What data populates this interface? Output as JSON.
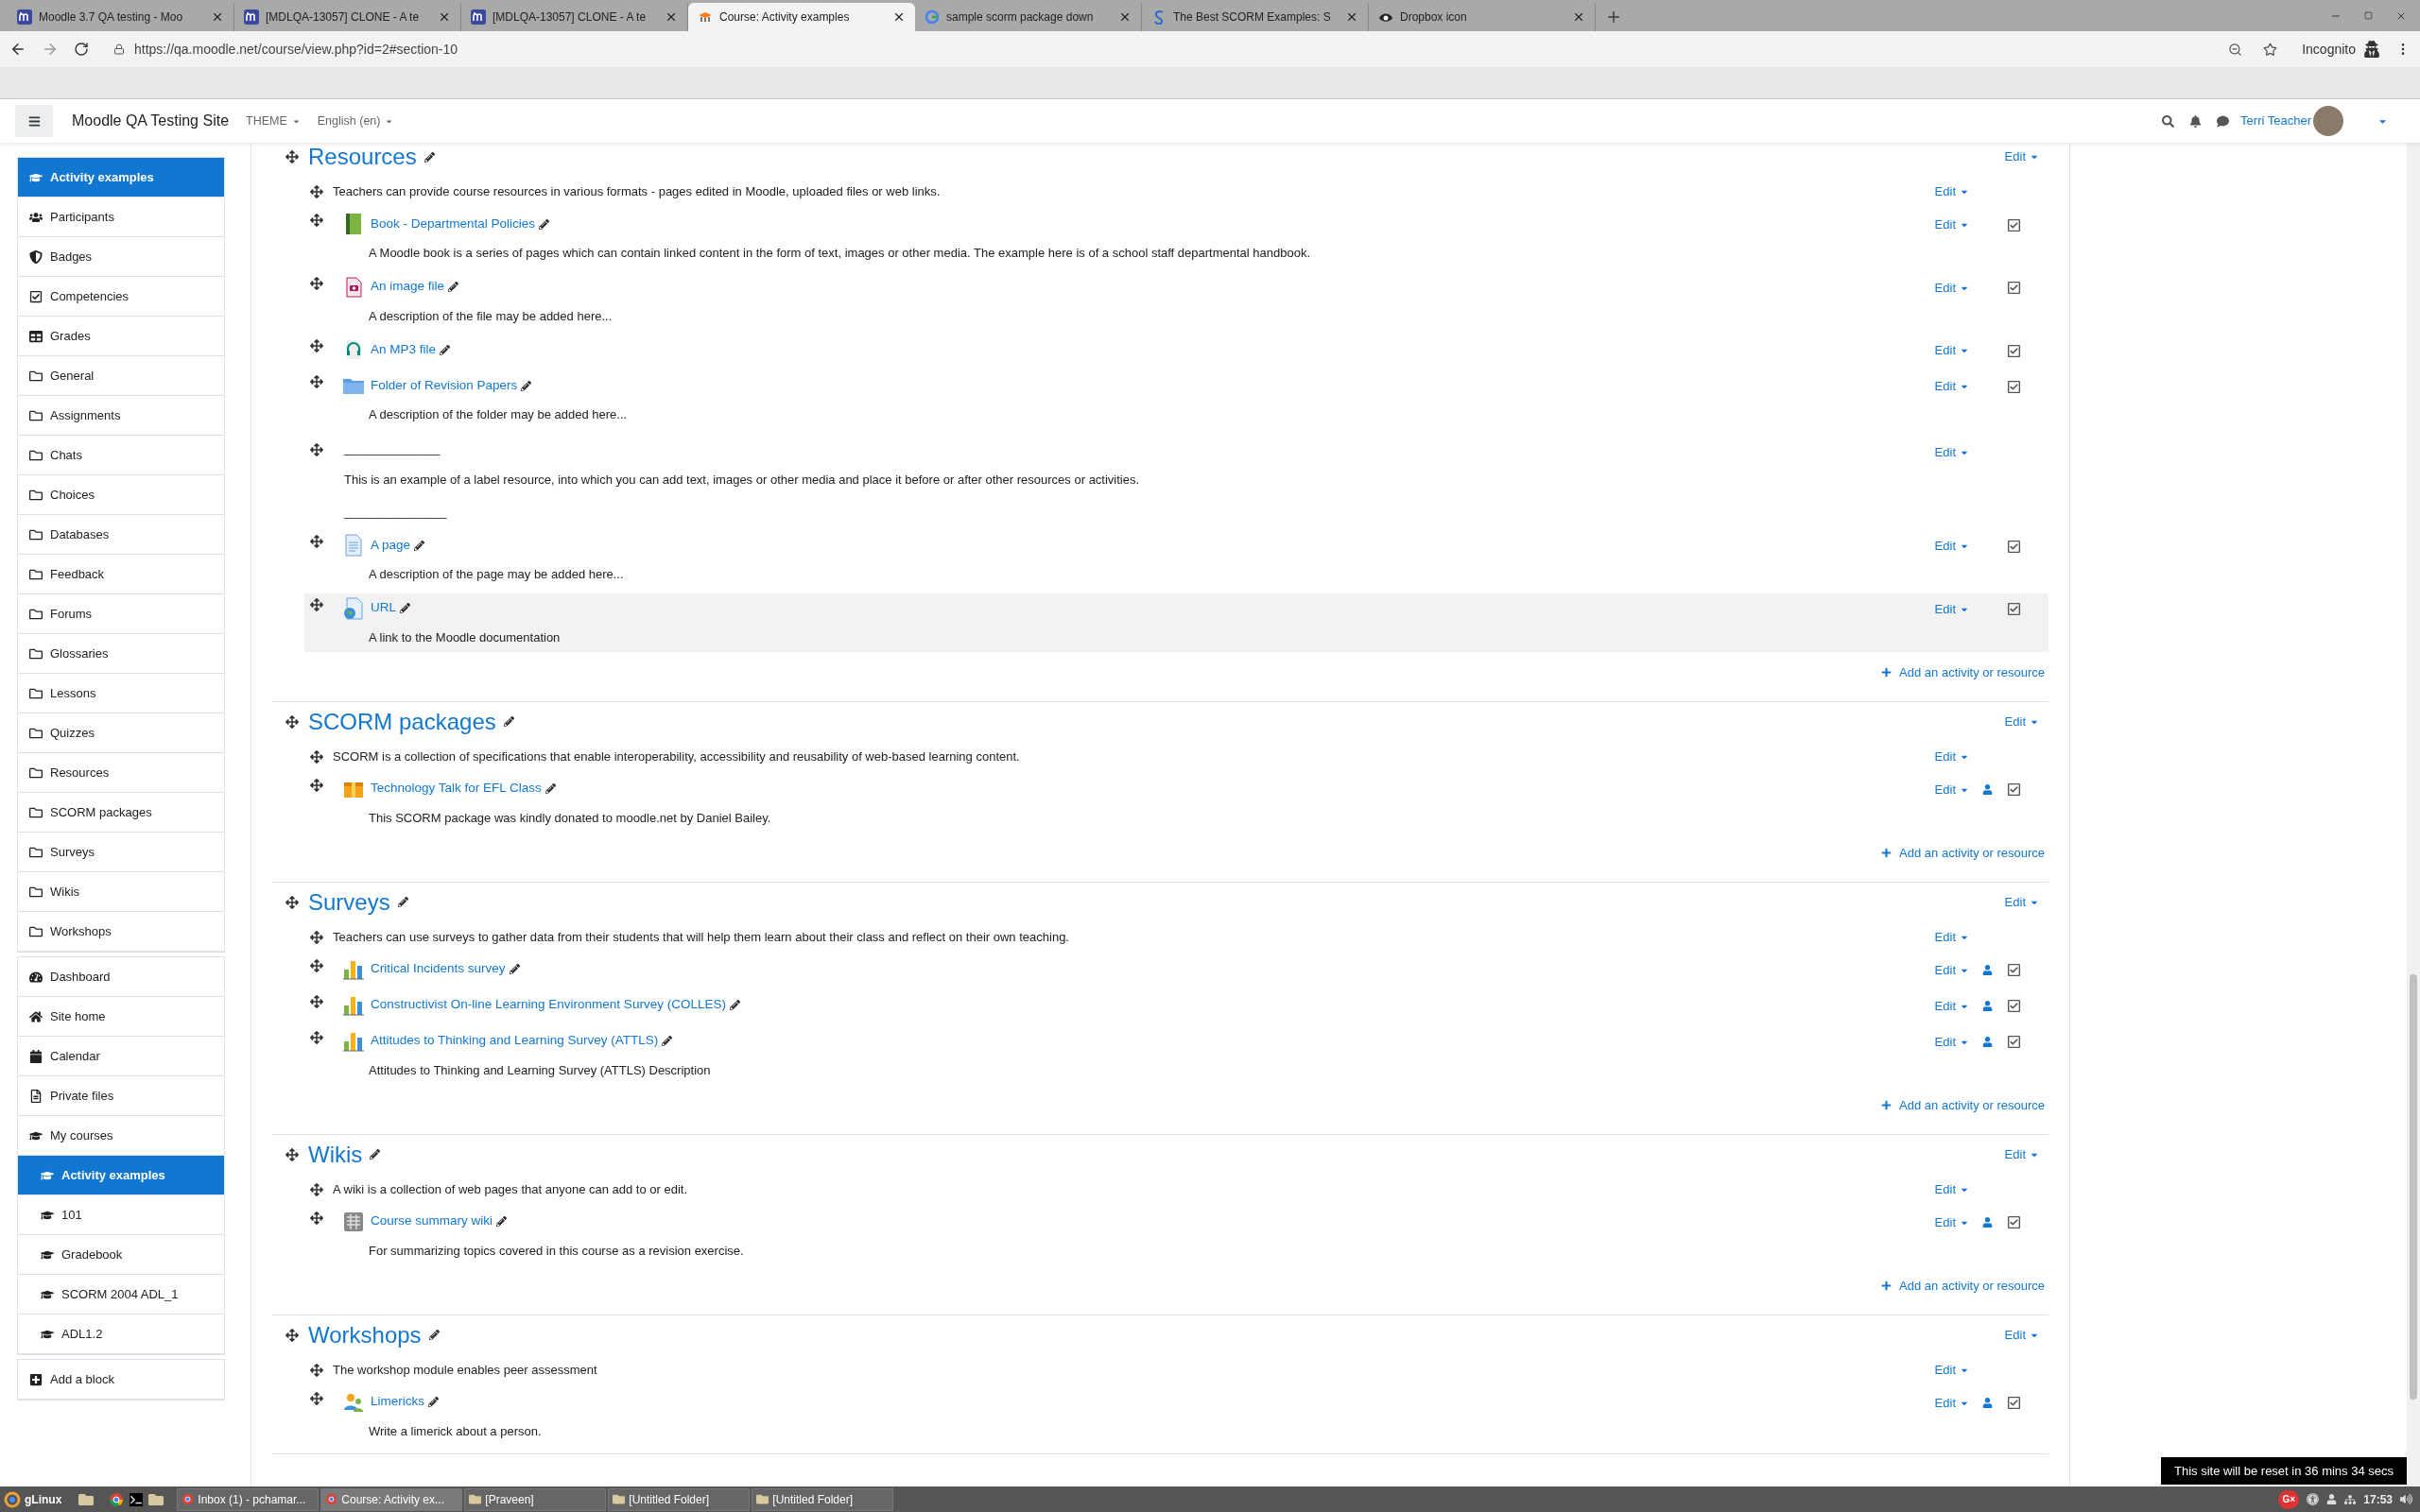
{
  "browser": {
    "tabs": [
      {
        "title": "Moodle 3.7 QA testing - Moo",
        "kind": "moodle",
        "selected": false
      },
      {
        "title": "[MDLQA-13057] CLONE - A te",
        "kind": "moodle",
        "selected": false
      },
      {
        "title": "[MDLQA-13057] CLONE - A te",
        "kind": "moodle",
        "selected": false
      },
      {
        "title": "Course: Activity examples",
        "kind": "moodle-hat",
        "selected": true
      },
      {
        "title": "sample scorm package down",
        "kind": "google",
        "selected": false
      },
      {
        "title": "The Best SCORM Examples: S",
        "kind": "s-logo",
        "selected": false
      },
      {
        "title": "Dropbox icon",
        "kind": "eye",
        "selected": false
      }
    ],
    "url": "https://qa.moodle.net/course/view.php?id=2#section-10",
    "profile": "Incognito"
  },
  "header": {
    "site_name": "Moodle QA Testing Site",
    "menus": [
      "THEME",
      "English (en)"
    ],
    "user": "Terri Teacher"
  },
  "sidebar": {
    "groups": [
      [
        {
          "label": "Activity examples",
          "kind": "course",
          "selected": true
        },
        {
          "label": "Participants",
          "kind": "users",
          "selected": false
        },
        {
          "label": "Badges",
          "kind": "badge",
          "selected": false
        },
        {
          "label": "Competencies",
          "kind": "check",
          "selected": false
        },
        {
          "label": "Grades",
          "kind": "table",
          "selected": false
        },
        {
          "label": "General",
          "kind": "folder",
          "selected": false
        },
        {
          "label": "Assignments",
          "kind": "folder",
          "selected": false
        },
        {
          "label": "Chats",
          "kind": "folder",
          "selected": false
        },
        {
          "label": "Choices",
          "kind": "folder",
          "selected": false
        },
        {
          "label": "Databases",
          "kind": "folder",
          "selected": false
        },
        {
          "label": "Feedback",
          "kind": "folder",
          "selected": false
        },
        {
          "label": "Forums",
          "kind": "folder",
          "selected": false
        },
        {
          "label": "Glossaries",
          "kind": "folder",
          "selected": false
        },
        {
          "label": "Lessons",
          "kind": "folder",
          "selected": false
        },
        {
          "label": "Quizzes",
          "kind": "folder",
          "selected": false
        },
        {
          "label": "Resources",
          "kind": "folder",
          "selected": false
        },
        {
          "label": "SCORM packages",
          "kind": "folder",
          "selected": false
        },
        {
          "label": "Surveys",
          "kind": "folder",
          "selected": false
        },
        {
          "label": "Wikis",
          "kind": "folder",
          "selected": false
        },
        {
          "label": "Workshops",
          "kind": "folder",
          "selected": false
        }
      ],
      [
        {
          "label": "Dashboard",
          "kind": "dashboard",
          "selected": false
        },
        {
          "label": "Site home",
          "kind": "home",
          "selected": false
        },
        {
          "label": "Calendar",
          "kind": "calendar",
          "selected": false
        },
        {
          "label": "Private files",
          "kind": "file",
          "selected": false
        },
        {
          "label": "My courses",
          "kind": "course",
          "selected": false
        },
        {
          "label": "Activity examples",
          "kind": "course",
          "selected": true
        },
        {
          "label": "101",
          "kind": "course",
          "selected": false
        },
        {
          "label": "Gradebook",
          "kind": "course",
          "selected": false
        },
        {
          "label": "SCORM 2004 ADL_1",
          "kind": "course",
          "selected": false
        },
        {
          "label": "ADL1.2",
          "kind": "course",
          "selected": false
        }
      ],
      [
        {
          "label": "Add a block",
          "kind": "add",
          "selected": false
        }
      ]
    ]
  },
  "sections": [
    {
      "title": "Resources",
      "edit": "Edit",
      "summary": {
        "text": "Teachers can provide course resources in various formats - pages edited in Moodle, uploaded files or web links.",
        "edit": "Edit"
      },
      "items": [
        {
          "kind": "book",
          "name": "Book - Departmental Policies",
          "description": "A  Moodle book is a series of pages which can contain linked content  in the form of text, images or other media. The example here is of a school staff departmental handbook.",
          "edit": "Edit",
          "group_mode": false,
          "completion_checked": true,
          "highlighted": false
        },
        {
          "kind": "image",
          "name": "An image file",
          "description": "A description of the file may be added here...",
          "edit": "Edit",
          "group_mode": false,
          "completion_checked": true,
          "highlighted": false
        },
        {
          "kind": "audio",
          "name": "An MP3 file",
          "edit": "Edit",
          "group_mode": false,
          "completion_checked": true,
          "highlighted": false
        },
        {
          "kind": "folder",
          "name": "Folder of Revision Papers",
          "description": "A description of the folder may be added here...",
          "edit": "Edit",
          "group_mode": false,
          "completion_checked": true,
          "highlighted": false
        },
        {
          "kind": "label",
          "lines": [
            "______________",
            "This is an example of a label resource, into which you can add text, images or other media and place it before or after other resources or activities.",
            "_______________"
          ],
          "edit": "Edit",
          "highlighted": false
        },
        {
          "kind": "page",
          "name": "A page",
          "description": "A description of the page may be added here...",
          "edit": "Edit",
          "group_mode": false,
          "completion_checked": true,
          "highlighted": false
        },
        {
          "kind": "url",
          "name": "URL",
          "description": "A link to the Moodle documentation",
          "edit": "Edit",
          "group_mode": false,
          "completion_checked": true,
          "highlighted": true
        }
      ],
      "add": "Add an activity or resource"
    },
    {
      "title": "SCORM packages",
      "edit": "Edit",
      "summary": {
        "text": "SCORM is a collection of specifications that enable interoperability, accessibility and reusability of web-based learning content.",
        "edit": "Edit"
      },
      "items": [
        {
          "kind": "scorm",
          "name": "Technology Talk for EFL Class",
          "description": "This SCORM package was kindly donated to moodle.net by Daniel Bailey.",
          "edit": "Edit",
          "group_mode": true,
          "completion_checked": true,
          "highlighted": false
        }
      ],
      "add": "Add an activity or resource"
    },
    {
      "title": "Surveys",
      "edit": "Edit",
      "summary": {
        "text": "Teachers can use surveys to gather data from their students that will help them learn about their class and reflect on their own teaching.",
        "edit": "Edit"
      },
      "items": [
        {
          "kind": "survey",
          "name": "Critical Incidents survey",
          "edit": "Edit",
          "group_mode": true,
          "completion_checked": true,
          "highlighted": false
        },
        {
          "kind": "survey",
          "name": "Constructivist On-line Learning Environment Survey (COLLES)",
          "edit": "Edit",
          "group_mode": true,
          "completion_checked": true,
          "highlighted": false
        },
        {
          "kind": "survey",
          "name": "Attitudes to Thinking and Learning Survey (ATTLS)",
          "description": "Attitudes to Thinking and Learning Survey (ATTLS) Description",
          "edit": "Edit",
          "group_mode": true,
          "completion_checked": true,
          "highlighted": false
        }
      ],
      "add": "Add an activity or resource"
    },
    {
      "title": "Wikis",
      "edit": "Edit",
      "summary": {
        "text": "A wiki is a collection of web pages that anyone can add to or edit.",
        "edit": "Edit"
      },
      "items": [
        {
          "kind": "wiki",
          "name": "Course summary wiki",
          "description": "For summarizing topics covered in this course as a revision exercise.",
          "edit": "Edit",
          "group_mode": true,
          "completion_checked": true,
          "highlighted": false
        }
      ],
      "add": "Add an activity or resource"
    },
    {
      "title": "Workshops",
      "edit": "Edit",
      "summary": {
        "text": "The workshop module enables peer assessment",
        "edit": "Edit"
      },
      "items": [
        {
          "kind": "workshop",
          "name": "Limericks",
          "description": "Write a limerick about a person.",
          "edit": "Edit",
          "group_mode": true,
          "completion_checked": true,
          "highlighted": false
        }
      ]
    }
  ],
  "reset_notice": "This site will be reset in 36 mins 34 secs",
  "taskbar": {
    "start": "gLinux",
    "windows": [
      {
        "title": "Inbox (1) - pchamar...",
        "kind": "chrome",
        "selected": false
      },
      {
        "title": "Course: Activity ex...",
        "kind": "chrome",
        "selected": true
      },
      {
        "title": "[Praveen]",
        "kind": "folder",
        "selected": false
      },
      {
        "title": "[Untitled Folder]",
        "kind": "folder",
        "selected": false
      },
      {
        "title": "[Untitled Folder]",
        "kind": "folder",
        "selected": false
      }
    ],
    "tray_badge": "G×",
    "clock": "17:53"
  }
}
